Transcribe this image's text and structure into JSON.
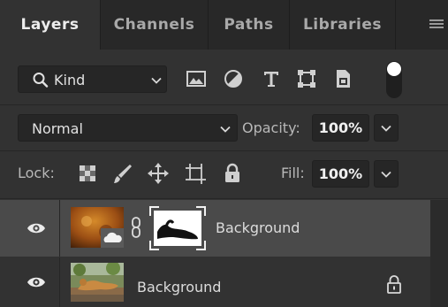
{
  "tabs": [
    {
      "label": "Layers",
      "active": true
    },
    {
      "label": "Channels",
      "active": false
    },
    {
      "label": "Paths",
      "active": false
    },
    {
      "label": "Libraries",
      "active": false
    }
  ],
  "filter": {
    "kind_label": "Kind",
    "icons": [
      "search-icon",
      "pixel-layer-filter-icon",
      "adjustment-layer-filter-icon",
      "type-layer-filter-icon",
      "shape-layer-filter-icon",
      "smart-object-filter-icon",
      "filter-toggle-icon"
    ]
  },
  "blend": {
    "mode": "Normal",
    "opacity_label": "Opacity:",
    "opacity_value": "100%"
  },
  "lock": {
    "label": "Lock:",
    "icons": [
      "lock-transparent-pixels-icon",
      "lock-image-pixels-icon",
      "lock-position-icon",
      "lock-artboard-icon",
      "lock-all-icon"
    ],
    "fill_label": "Fill:",
    "fill_value": "100%"
  },
  "layers": [
    {
      "name": "Background",
      "selected": true,
      "has_mask": true,
      "locked": false,
      "visible": true
    },
    {
      "name": "Background",
      "selected": false,
      "has_mask": false,
      "locked": true,
      "visible": true
    }
  ],
  "colors": {
    "panel_bg": "#323232",
    "tab_bar_bg": "#282828",
    "selected_layer_bg": "#4a4a4a",
    "text": "#d6d6d6"
  }
}
